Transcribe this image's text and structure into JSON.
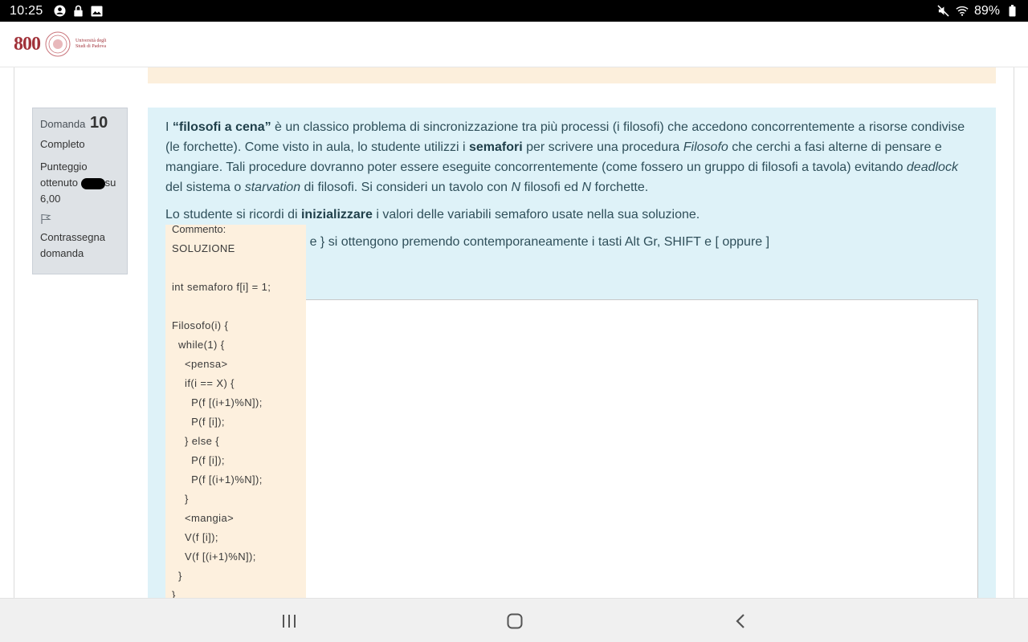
{
  "status_bar": {
    "time": "10:25",
    "battery": "89%"
  },
  "header": {
    "logo_year": "800",
    "logo_text": "Università degli Studi di Padova"
  },
  "question_info": {
    "label": "Domanda",
    "number": "10",
    "state": "Completo",
    "grade_prefix": "Punteggio ottenuto",
    "grade_suffix": "su",
    "grade_max": "6,00",
    "flag_label": "Contrassegna domanda"
  },
  "question": {
    "p1_intro": "I ",
    "p1_bold1": "“filosofi a cena”",
    "p1_a": " è un classico problema di sincronizzazione tra più processi (i filosofi) che accedono concorrentemente a risorse condivise (le forchette). Come visto in aula, lo studente utilizzi i ",
    "p1_bold2": "semafori",
    "p1_b": " per scrivere una procedura ",
    "p1_italic1": "Filosofo",
    "p1_c": " che cerchi a fasi alterne di pensare e mangiare. Tali procedure dovranno poter essere eseguite concorrentemente (come fossero un gruppo di filosofi a tavola) evitando ",
    "p1_italic2": "deadlock",
    "p1_d": " del sistema o ",
    "p1_italic3": "starvation",
    "p1_e": " di filosofi. Si consideri un tavolo con ",
    "p1_italic4": "N",
    "p1_f": " filosofi ed ",
    "p1_italic5": "N",
    "p1_g": " forchette.",
    "p2_a": "Lo studente si ricordi di ",
    "p2_bold": "inizializzare",
    "p2_b": " i valori delle variabili semaforo usate nella sua soluzione.",
    "p3_visible": "fe  { e }  si ottengono premendo contemporaneamente i tasti Alt Gr, SHIFT e [ oppure ]"
  },
  "comment": {
    "title": "Commento:",
    "lines": [
      "SOLUZIONE",
      "",
      "int semaforo f[i] = 1;",
      "",
      "Filosofo(i) {",
      "  while(1) {",
      "    <pensa>",
      "    if(i == X) {",
      "      P(f [(i+1)%N]);",
      "      P(f [i]);",
      "    } else {",
      "      P(f [i]);",
      "      P(f [(i+1)%N]);",
      "    }",
      "    <mangia>",
      "    V(f [i]);",
      "    V(f [(i+1)%N]);",
      "  }",
      "}"
    ]
  },
  "icons": {
    "status_left": [
      "account-circle-icon",
      "lock-icon",
      "image-icon"
    ],
    "status_right": [
      "mute-icon",
      "wifi-icon",
      "battery-icon"
    ],
    "nav": [
      "recent-apps-icon",
      "home-icon",
      "back-icon"
    ]
  }
}
